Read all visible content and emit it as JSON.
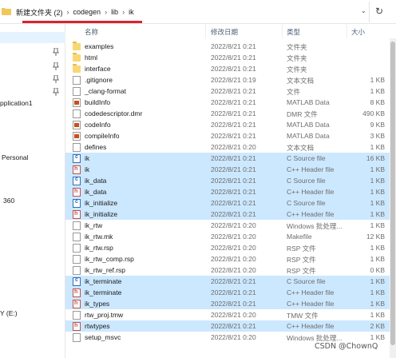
{
  "address_bar": {
    "crumbs": [
      "新建文件夹 (2)",
      "codegen",
      "lib",
      "ik"
    ],
    "separator": "›",
    "dropdown_icon": "chevron-down-icon",
    "refresh_icon": "refresh-icon"
  },
  "nav": {
    "items": [
      "pplication1",
      "Personal",
      "360",
      "Y (E:)"
    ],
    "pin_icon": "pin-icon"
  },
  "columns": [
    "名称",
    "修改日期",
    "类型",
    "大小"
  ],
  "files": [
    {
      "name": "examples",
      "date": "2022/8/21 0:21",
      "type": "文件夹",
      "size": "",
      "icon": "folder-icon",
      "selected": false
    },
    {
      "name": "html",
      "date": "2022/8/21 0:21",
      "type": "文件夹",
      "size": "",
      "icon": "folder-icon",
      "selected": false
    },
    {
      "name": "interface",
      "date": "2022/8/21 0:21",
      "type": "文件夹",
      "size": "",
      "icon": "folder-icon",
      "selected": false
    },
    {
      "name": ".gitignore",
      "date": "2022/8/21 0:19",
      "type": "文本文档",
      "size": "1 KB",
      "icon": "file-icon",
      "selected": false
    },
    {
      "name": "_clang-format",
      "date": "2022/8/21 0:21",
      "type": "文件",
      "size": "1 KB",
      "icon": "file-icon",
      "selected": false
    },
    {
      "name": "buildInfo",
      "date": "2022/8/21 0:21",
      "type": "MATLAB Data",
      "size": "8 KB",
      "icon": "matlab-data-icon",
      "selected": false
    },
    {
      "name": "codedescriptor.dmr",
      "date": "2022/8/21 0:21",
      "type": "DMR 文件",
      "size": "490 KB",
      "icon": "file-icon",
      "selected": false
    },
    {
      "name": "codeInfo",
      "date": "2022/8/21 0:21",
      "type": "MATLAB Data",
      "size": "9 KB",
      "icon": "matlab-data-icon",
      "selected": false
    },
    {
      "name": "compileInfo",
      "date": "2022/8/21 0:21",
      "type": "MATLAB Data",
      "size": "3 KB",
      "icon": "matlab-data-icon",
      "selected": false
    },
    {
      "name": "defines",
      "date": "2022/8/21 0:20",
      "type": "文本文档",
      "size": "1 KB",
      "icon": "file-icon",
      "selected": false
    },
    {
      "name": "ik",
      "date": "2022/8/21 0:21",
      "type": "C Source file",
      "size": "16 KB",
      "icon": "c-source-icon",
      "selected": true
    },
    {
      "name": "ik",
      "date": "2022/8/21 0:21",
      "type": "C++ Header file",
      "size": "1 KB",
      "icon": "header-file-icon",
      "selected": true
    },
    {
      "name": "ik_data",
      "date": "2022/8/21 0:21",
      "type": "C Source file",
      "size": "1 KB",
      "icon": "c-source-icon",
      "selected": true
    },
    {
      "name": "ik_data",
      "date": "2022/8/21 0:21",
      "type": "C++ Header file",
      "size": "1 KB",
      "icon": "header-file-icon",
      "selected": true
    },
    {
      "name": "ik_initialize",
      "date": "2022/8/21 0:21",
      "type": "C Source file",
      "size": "1 KB",
      "icon": "c-source-icon",
      "selected": true
    },
    {
      "name": "ik_initialize",
      "date": "2022/8/21 0:21",
      "type": "C++ Header file",
      "size": "1 KB",
      "icon": "header-file-icon",
      "selected": true
    },
    {
      "name": "ik_rtw",
      "date": "2022/8/21 0:20",
      "type": "Windows 批处理...",
      "size": "1 KB",
      "icon": "file-icon",
      "selected": false
    },
    {
      "name": "ik_rtw.mk",
      "date": "2022/8/21 0:20",
      "type": "Makefile",
      "size": "12 KB",
      "icon": "file-icon",
      "selected": false
    },
    {
      "name": "ik_rtw.rsp",
      "date": "2022/8/21 0:20",
      "type": "RSP 文件",
      "size": "1 KB",
      "icon": "file-icon",
      "selected": false
    },
    {
      "name": "ik_rtw_comp.rsp",
      "date": "2022/8/21 0:20",
      "type": "RSP 文件",
      "size": "1 KB",
      "icon": "file-icon",
      "selected": false
    },
    {
      "name": "ik_rtw_ref.rsp",
      "date": "2022/8/21 0:20",
      "type": "RSP 文件",
      "size": "0 KB",
      "icon": "file-icon",
      "selected": false
    },
    {
      "name": "ik_terminate",
      "date": "2022/8/21 0:21",
      "type": "C Source file",
      "size": "1 KB",
      "icon": "c-source-icon",
      "selected": true
    },
    {
      "name": "ik_terminate",
      "date": "2022/8/21 0:21",
      "type": "C++ Header file",
      "size": "1 KB",
      "icon": "header-file-icon",
      "selected": true
    },
    {
      "name": "ik_types",
      "date": "2022/8/21 0:21",
      "type": "C++ Header file",
      "size": "1 KB",
      "icon": "header-file-icon",
      "selected": true
    },
    {
      "name": "rtw_proj.tmw",
      "date": "2022/8/21 0:20",
      "type": "TMW 文件",
      "size": "1 KB",
      "icon": "file-icon",
      "selected": false
    },
    {
      "name": "rtwtypes",
      "date": "2022/8/21 0:21",
      "type": "C++ Header file",
      "size": "2 KB",
      "icon": "header-file-icon",
      "selected": true
    },
    {
      "name": "setup_msvc",
      "date": "2022/8/21 0:20",
      "type": "Windows 批处理...",
      "size": "1 KB",
      "icon": "file-icon",
      "selected": false
    }
  ],
  "watermark": "CSDN @ChownQ",
  "colors": {
    "selection": "#cce8ff",
    "header_text": "#4c607a",
    "annotation_red": "#d9232e"
  }
}
